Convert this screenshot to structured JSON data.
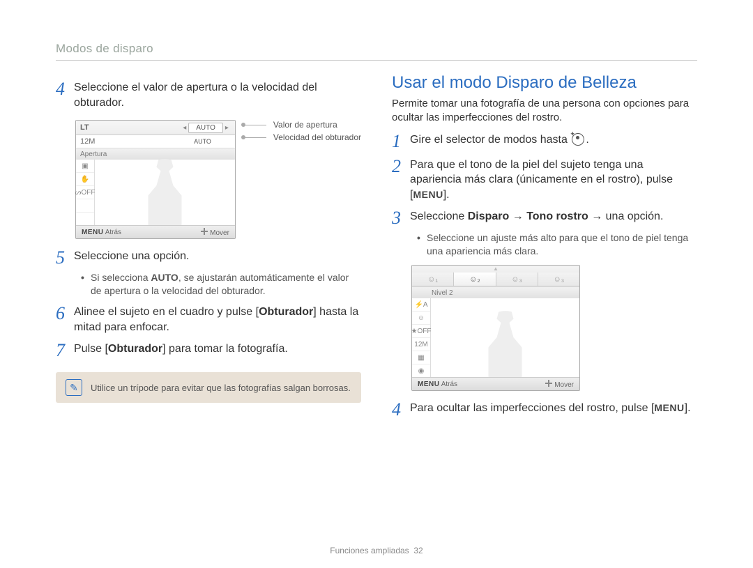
{
  "header": {
    "breadcrumb": "Modos de disparo"
  },
  "left": {
    "step4": "Seleccione el valor de apertura o la velocidad del obturador.",
    "callout1": "Valor de apertura",
    "callout2": "Velocidad del obturador",
    "lcd_aperture": {
      "top_left": "LT",
      "auto1": "AUTO",
      "auto2": "AUTO",
      "side": {
        "a": "12M",
        "b": "▣",
        "c": "✋",
        "d": "ᔕOFF"
      },
      "band_label": "Apertura",
      "bot_menu": "MENU",
      "bot_back": "Atrás",
      "bot_move": "Mover"
    },
    "step5": "Seleccione una opción.",
    "step5_bullet": "Si selecciona AUTO, se ajustarán automáticamente el valor de apertura o la velocidad del obturador.",
    "step5_bullet_bold": "AUTO",
    "step6_a": "Alinee el sujeto en el cuadro y pulse [",
    "step6_b": "Obturador",
    "step6_c": "] hasta la mitad para enfocar.",
    "step7_a": "Pulse [",
    "step7_b": "Obturador",
    "step7_c": "] para tomar la fotografía.",
    "note": "Utilice un trípode para evitar que las fotografías salgan borrosas."
  },
  "right": {
    "title": "Usar el modo Disparo de Belleza",
    "subtitle": "Permite tomar una fotografía de una persona con opciones para ocultar las imperfecciones del rostro.",
    "step1": "Gire el selector de modos hasta ",
    "step2": "Para que el tono de la piel del sujeto tenga una apariencia más clara (únicamente en el rostro), pulse [MENU].",
    "step2_menu": "MENU",
    "step3_a": "Seleccione ",
    "step3_b": "Disparo",
    "step3_arrow": " → ",
    "step3_c": "Tono rostro",
    "step3_d": " → una opción.",
    "step3_bullet": "Seleccione un ajuste más alto para que el tono de piel tenga una apariencia más clara.",
    "lcd_beauty": {
      "tabs": [
        "☺₁",
        "☺₂",
        "☺₃",
        "☺₃"
      ],
      "side": {
        "a": "⚡A",
        "b": "☺",
        "c": "★OFF",
        "d": "12M",
        "e": "▦",
        "f": "◉"
      },
      "band_label": "Nivel 2",
      "bot_menu": "MENU",
      "bot_back": "Atrás",
      "bot_move": "Mover"
    },
    "step4_a": "Para ocultar las imperfecciones del rostro, pulse [",
    "step4_b": "MENU",
    "step4_c": "]."
  },
  "footer": {
    "section": "Funciones ampliadas",
    "page": "32"
  }
}
